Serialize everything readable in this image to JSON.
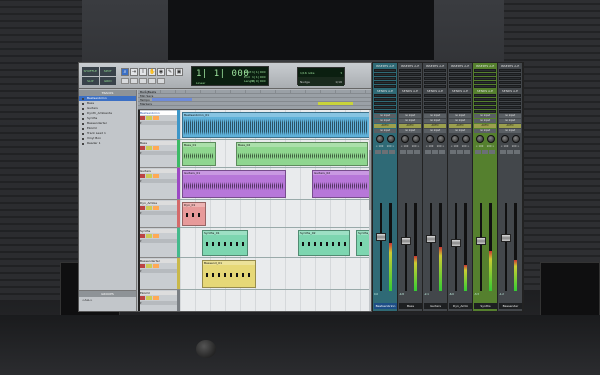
{
  "transport": {
    "modes": [
      "SHUFFLE",
      "SPOT",
      "SLIP",
      "GRID"
    ],
    "counter_main": "1| 1| 000",
    "counter_sub": "Linear",
    "sel_labels": [
      "Start",
      "End",
      "Length"
    ],
    "sel_values": [
      "1| 1| 000",
      "1| 1| 000",
      "0| 0| 000"
    ],
    "grid_label": "1/16 note",
    "nudge_label": "Nudge",
    "nudge_value": "1/16"
  },
  "tracks_panel": {
    "title": "TRACKS",
    "items": [
      "Bestsenbrinn",
      "Bass",
      "Guitars",
      "Dynth_Ambiente",
      "Synths",
      "Bassenderter",
      "Ekomil",
      "Track Lead 1",
      "Vinyl Box",
      "Reader 1"
    ]
  },
  "groups_panel": {
    "title": "GROUPS",
    "items": [
      "<ALL>"
    ]
  },
  "rulers": [
    "Bars|Beats",
    "Min:Secs",
    "Tempo",
    "Markers"
  ],
  "lanes": [
    {
      "name": "Bestsenbrinn",
      "color": "#3c96c8",
      "selected": true
    },
    {
      "name": "Bass",
      "color": "#3cba66",
      "selected": false
    },
    {
      "name": "Guitars",
      "color": "#9c49c4",
      "selected": false
    },
    {
      "name": "Dyn_Ambie",
      "color": "#d46a6a",
      "selected": false
    },
    {
      "name": "Synths",
      "color": "#44b98c",
      "selected": false
    },
    {
      "name": "Bassenderter",
      "color": "#c9b84a",
      "selected": false
    },
    {
      "name": "Ekomil",
      "color": "#7a7f84",
      "selected": false
    }
  ],
  "clips": [
    {
      "name": "Bestsenbrinn_01",
      "color": "#5fb1d9"
    },
    {
      "name": "Bass_01",
      "color": "#8fd68f"
    },
    {
      "name": "Bass_02",
      "color": "#8fd68f"
    },
    {
      "name": "Guitars_01",
      "color": "#b777d9"
    },
    {
      "name": "Guitars_02",
      "color": "#b777d9"
    },
    {
      "name": "Dyn_01",
      "color": "#e79a9a"
    },
    {
      "name": "Synths_01",
      "color": "#7dd6b0"
    },
    {
      "name": "Synths_02",
      "color": "#7dd6b0"
    },
    {
      "name": "Synths_03",
      "color": "#7dd6b0"
    },
    {
      "name": "Bassend_01",
      "color": "#e6d877"
    }
  ],
  "mixer": {
    "strips": [
      {
        "name": "Bestsenbrinn",
        "style": "sel",
        "insert": "SENDS A-E",
        "io": "no input",
        "auto": "AUTO",
        "vol": "0.0",
        "fader": 0.62,
        "meter": 0.55
      },
      {
        "name": "Bass",
        "style": "normal",
        "insert": "SENDS A-E",
        "io": "no input",
        "auto": "AUTO",
        "vol": "-4.8",
        "fader": 0.58,
        "meter": 0.4
      },
      {
        "name": "Guitars",
        "style": "normal",
        "insert": "SENDS A-E",
        "io": "no input",
        "auto": "AUTO",
        "vol": "-2.1",
        "fader": 0.6,
        "meter": 0.5
      },
      {
        "name": "Dyn_Ambi",
        "style": "normal",
        "insert": "SENDS A-E",
        "io": "no input",
        "auto": "AUTO",
        "vol": "-6.0",
        "fader": 0.55,
        "meter": 0.3
      },
      {
        "name": "Synths",
        "style": "grn",
        "insert": "SENDS A-E",
        "io": "no input",
        "auto": "AUTO",
        "vol": "-3.3",
        "fader": 0.57,
        "meter": 0.45
      },
      {
        "name": "Bassender",
        "style": "normal",
        "insert": "SENDS A-E",
        "io": "no input",
        "auto": "AUTO",
        "vol": "-1.2",
        "fader": 0.61,
        "meter": 0.35
      }
    ],
    "inserts_label": "INSERTS A-E",
    "pan_values": [
      "< 100",
      "100 >"
    ]
  }
}
